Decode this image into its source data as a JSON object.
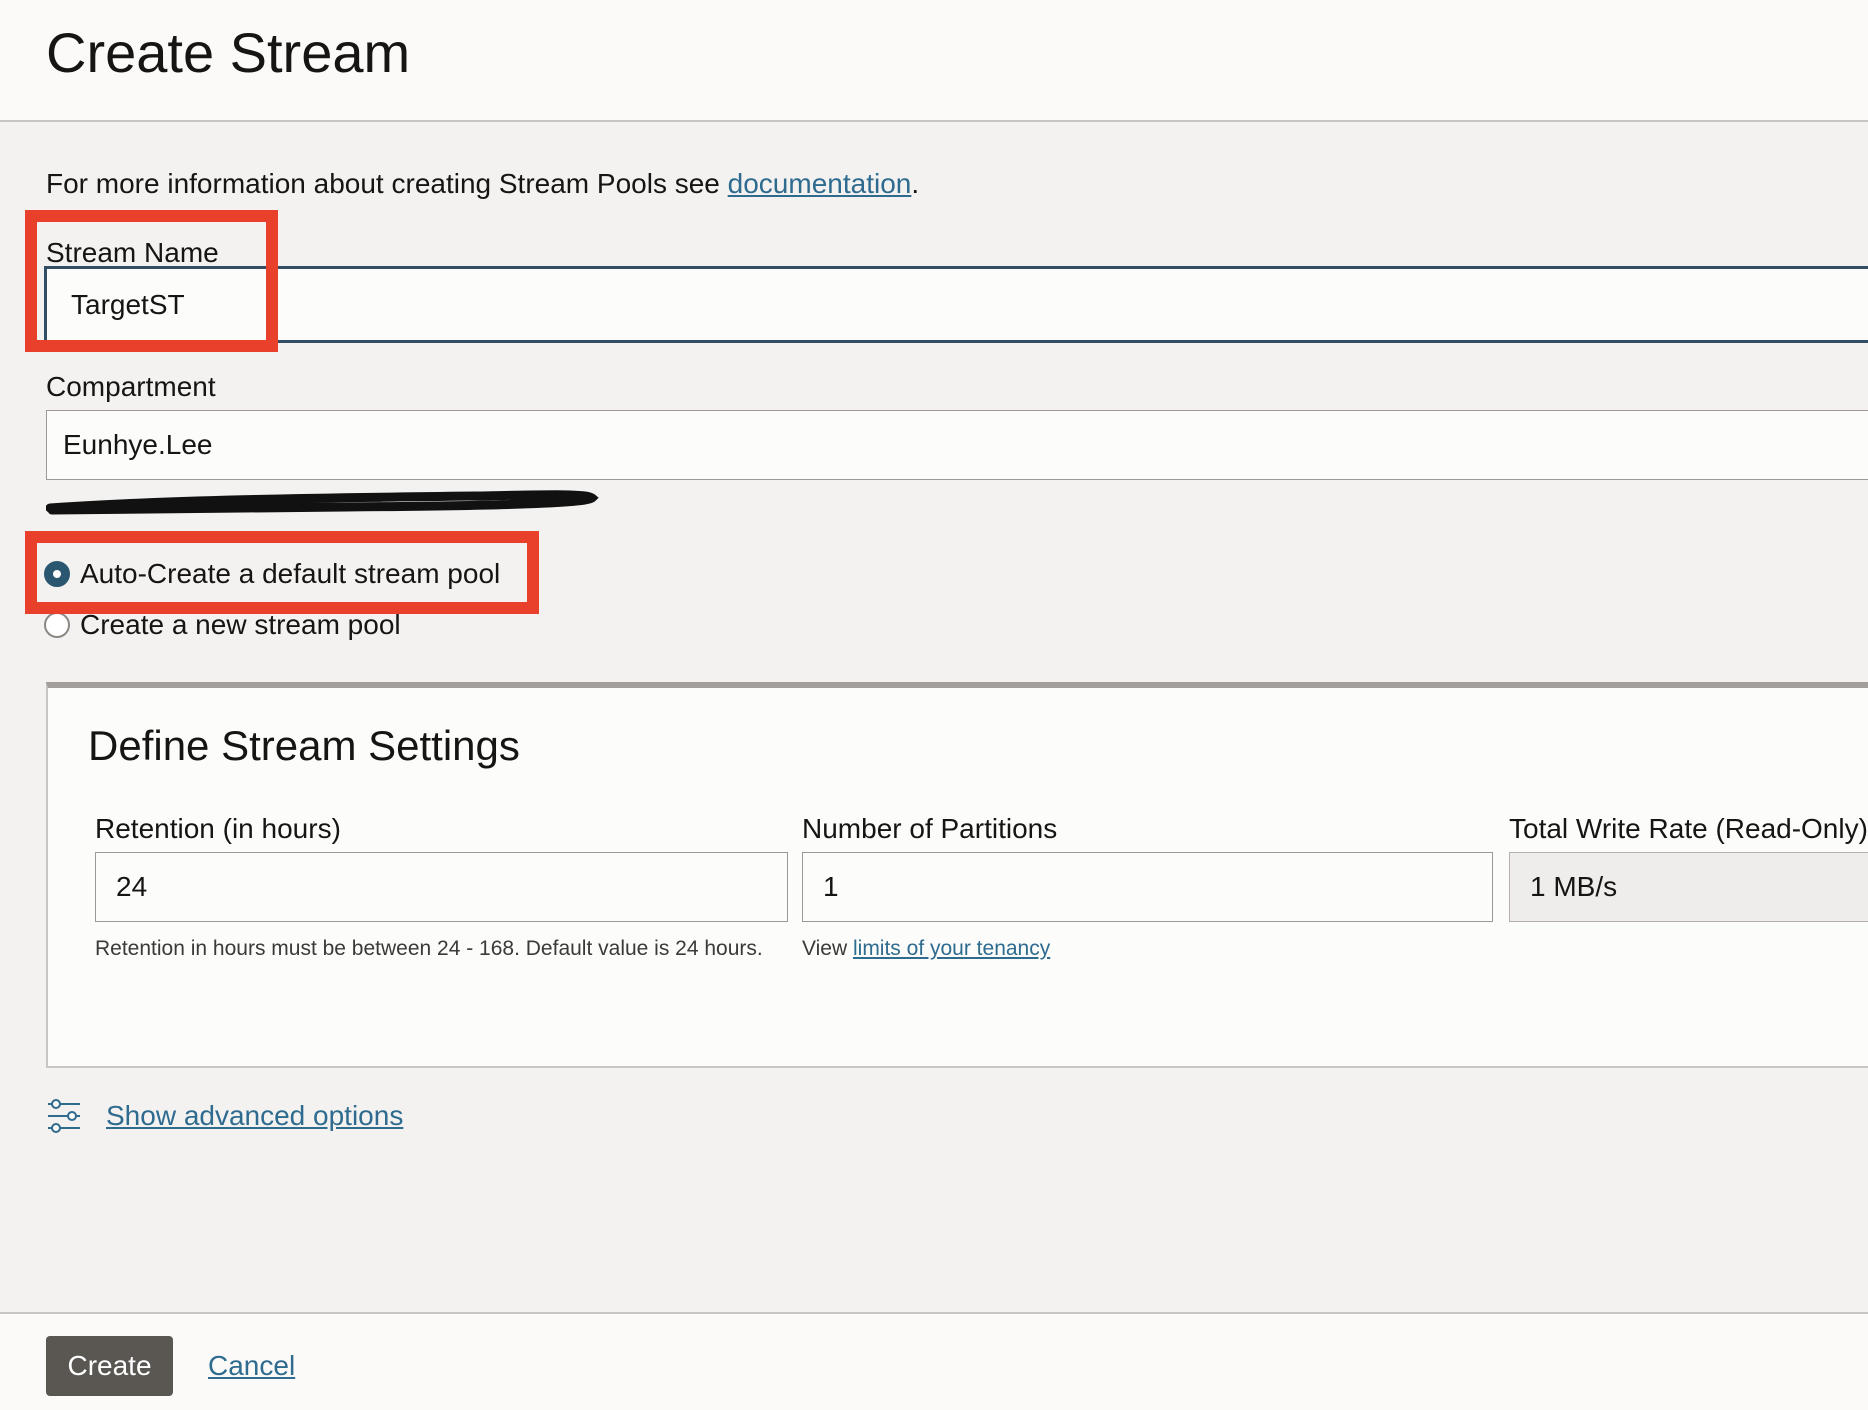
{
  "page": {
    "title": "Create Stream"
  },
  "info": {
    "prefix": "For more information about creating Stream Pools see ",
    "link_text": "documentation",
    "suffix": "."
  },
  "stream_name": {
    "label": "Stream Name",
    "value": "TargetST"
  },
  "compartment": {
    "label": "Compartment",
    "value": "Eunhye.Lee",
    "path_redacted": "(redacted)"
  },
  "stream_pool": {
    "options": [
      {
        "label": "Auto-Create a default stream pool",
        "checked": true
      },
      {
        "label": "Create a new stream pool",
        "checked": false
      }
    ]
  },
  "settings": {
    "title": "Define Stream Settings",
    "retention": {
      "label": "Retention (in hours)",
      "value": "24",
      "help": "Retention in hours must be between 24 - 168. Default value is 24 hours."
    },
    "partitions": {
      "label": "Number of Partitions",
      "value": "1",
      "help_prefix": "View ",
      "help_link": "limits of your tenancy"
    },
    "write_rate": {
      "label": "Total Write Rate (Read-Only)",
      "value": "1 MB/s"
    }
  },
  "advanced": {
    "label": "Show advanced options",
    "icon": "sliders-icon"
  },
  "footer": {
    "create_label": "Create",
    "cancel_label": "Cancel"
  },
  "colors": {
    "highlight": "#e8402a",
    "link": "#2e6b8f",
    "primary_button": "#5a5652",
    "focused_border": "#314e64"
  }
}
